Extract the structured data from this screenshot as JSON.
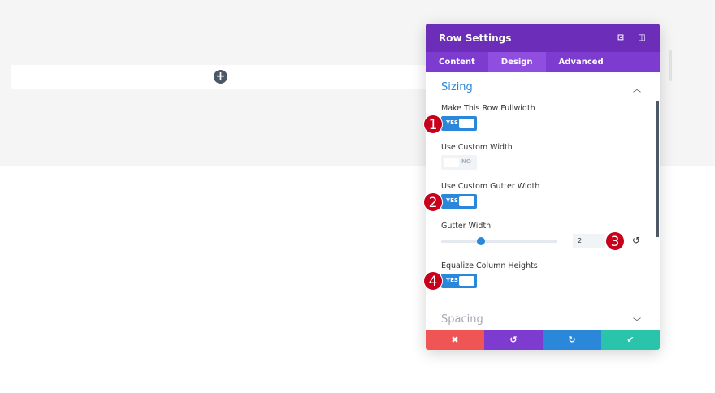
{
  "panel": {
    "title": "Row Settings",
    "tabs": [
      "Content",
      "Design",
      "Advanced"
    ],
    "icons": [
      "expand-icon",
      "sidebar-toggle-icon"
    ]
  },
  "sizing": {
    "title": "Sizing",
    "fullwidth": {
      "label": "Make This Row Fullwidth",
      "value": "YES"
    },
    "custom_width": {
      "label": "Use Custom Width",
      "value": "NO"
    },
    "custom_gutter": {
      "label": "Use Custom Gutter Width",
      "value": "YES"
    },
    "gutter_width": {
      "label": "Gutter Width",
      "value": "2",
      "range": [
        1,
        4
      ]
    },
    "equalize": {
      "label": "Equalize Column Heights",
      "value": "YES"
    }
  },
  "spacing": {
    "title": "Spacing"
  },
  "badges": [
    "1",
    "2",
    "3",
    "4"
  ],
  "footer": {
    "colors": [
      "#ef5555",
      "#7e3bd0",
      "#2b87da",
      "#29c4a9"
    ]
  }
}
